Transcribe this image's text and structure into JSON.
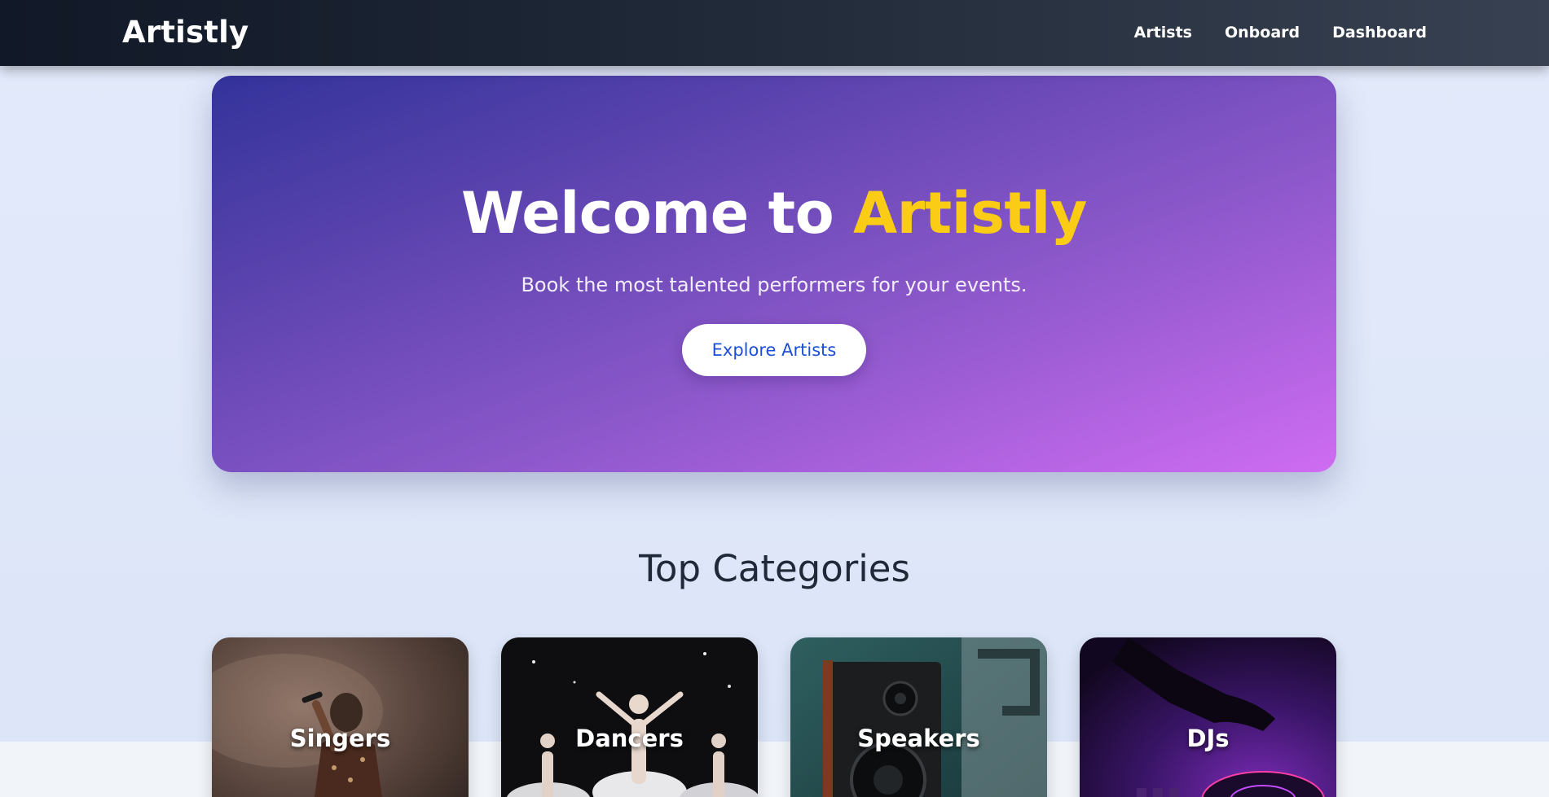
{
  "nav": {
    "brand": "Artistly",
    "links": [
      "Artists",
      "Onboard",
      "Dashboard"
    ]
  },
  "hero": {
    "title_prefix": "Welcome to ",
    "title_accent": "Artistly",
    "subtitle": "Book the most talented performers for your events.",
    "button_label": "Explore Artists"
  },
  "categories": {
    "heading": "Top Categories",
    "items": [
      {
        "label": "Singers",
        "icon": "singer-photo"
      },
      {
        "label": "Dancers",
        "icon": "dancers-photo"
      },
      {
        "label": "Speakers",
        "icon": "speaker-photo"
      },
      {
        "label": "DJs",
        "icon": "dj-photo"
      }
    ]
  },
  "colors": {
    "nav_bg": "#1f2937",
    "accent": "#facc15",
    "button_text": "#1d4ed8",
    "hero_start": "#33339b",
    "hero_end": "#cf6cf2"
  }
}
